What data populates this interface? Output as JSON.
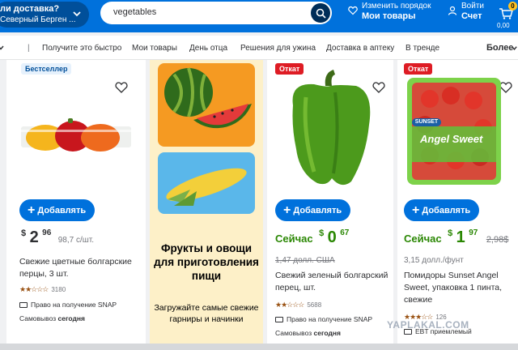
{
  "header": {
    "delivery_line1": "ли доставка?",
    "delivery_line2": "Северный Берген ...",
    "search_value": "vegetables",
    "orders_small": "Изменить порядок",
    "orders_big": "Мои товары",
    "account_small": "Войти",
    "account_big": "Счет",
    "cart_count": "0",
    "cart_total": "0,00"
  },
  "nav": {
    "items": [
      "Получите это быстро",
      "Мои товары",
      "День отца",
      "Решения для ужина",
      "Доставка в аптеку",
      "В тренде"
    ],
    "more": "Более"
  },
  "products": [
    {
      "badge": "Бестселлер",
      "add_label": "Добавлять",
      "price_currency": "$",
      "price_int": "2",
      "price_cents": "96",
      "unit_price": "98,7 с/шт.",
      "title": "Свежие цветные болгарские перцы, 3 шт.",
      "stars": "★★☆☆☆",
      "reviews": "3180",
      "snap": "Право на получение SNAP",
      "pickup_prefix": "Самовывоз",
      "pickup_when": "сегодня"
    },
    {
      "badge": "Откат",
      "add_label": "Добавлять",
      "now_label": "Сейчас",
      "price_currency": "$",
      "price_int": "0",
      "price_cents": "67",
      "was_price": "1,47 долл. США",
      "title": "Свежий зеленый болгарский перец, шт.",
      "stars": "★★☆☆☆",
      "reviews": "5688",
      "snap": "Право на получение SNAP",
      "pickup_prefix": "Самовывоз",
      "pickup_when": "сегодня"
    },
    {
      "badge": "Откат",
      "add_label": "Добавлять",
      "now_label": "Сейчас",
      "price_currency": "$",
      "price_int": "1",
      "price_cents": "97",
      "was_price": "2,98$",
      "unit_price": "3,15 долл./фунт",
      "title": "Помидоры Sunset Angel Sweet, упаковка 1 пинта, свежие",
      "stars": "★★★☆☆",
      "reviews": "126",
      "snap": "EBT приемлемый"
    }
  ],
  "promo": {
    "title": "Фрукты и овощи для приготовления пищи",
    "subtitle": "Загружайте самые свежие гарниры и начинки"
  },
  "packaging": {
    "brand": "SUNSET",
    "product": "Angel Sweet"
  },
  "watermark": "YAPLAKAL.COM",
  "colors": {
    "brand_blue": "#0071dc",
    "dark_blue": "#004f9a",
    "rollback_red": "#de1c24",
    "price_green": "#2a8703",
    "promo_yellow": "#fdf0c8"
  }
}
